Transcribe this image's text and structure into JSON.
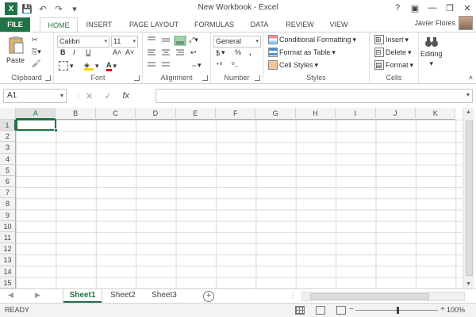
{
  "window": {
    "title": "New Workbook - Excel",
    "help": "?",
    "minimize": "—",
    "restore": "❐",
    "close": "✕"
  },
  "qat": {
    "save": "💾",
    "undo": "↶",
    "redo": "↷",
    "customize": "▾"
  },
  "tabs": [
    "FILE",
    "HOME",
    "INSERT",
    "PAGE LAYOUT",
    "FORMULAS",
    "DATA",
    "REVIEW",
    "VIEW"
  ],
  "user": {
    "name": "Javier Flores"
  },
  "ribbon": {
    "clipboard": {
      "label": "Clipboard",
      "paste": "Paste"
    },
    "font": {
      "label": "Font",
      "name": "Calibri",
      "size": "11",
      "bold": "B",
      "italic": "I",
      "underline": "U",
      "grow": "A˄",
      "shrink": "A˅"
    },
    "alignment": {
      "label": "Alignment"
    },
    "number": {
      "label": "Number",
      "format": "General",
      "currency": "$",
      "percent": "%",
      "comma": ","
    },
    "styles": {
      "label": "Styles",
      "conditional": "Conditional Formatting",
      "table": "Format as Table",
      "cell_styles": "Cell Styles"
    },
    "cells": {
      "label": "Cells",
      "insert": "Insert",
      "delete": "Delete",
      "format": "Format"
    },
    "editing": {
      "label": "Editing"
    }
  },
  "formula_bar": {
    "name_box": "A1",
    "cancel": "✕",
    "enter": "✓",
    "fx": "fx",
    "value": ""
  },
  "grid": {
    "columns": [
      "A",
      "B",
      "C",
      "D",
      "E",
      "F",
      "G",
      "H",
      "I",
      "J",
      "K"
    ],
    "rows": [
      "1",
      "2",
      "3",
      "4",
      "5",
      "6",
      "7",
      "8",
      "9",
      "10",
      "11",
      "12",
      "13",
      "14",
      "15"
    ],
    "selected_cell": "A1"
  },
  "sheets": [
    "Sheet1",
    "Sheet2",
    "Sheet3"
  ],
  "active_sheet": "Sheet1",
  "status": {
    "text": "READY",
    "zoom": "100%",
    "zoom_minus": "−",
    "zoom_plus": "+"
  },
  "colors": {
    "accent": "#217346"
  }
}
